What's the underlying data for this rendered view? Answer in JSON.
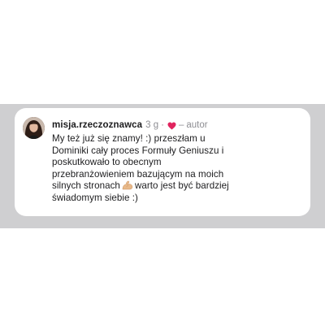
{
  "comment": {
    "username": "misja.rzeczoznawca",
    "time_ago": "3 g",
    "separator": "·",
    "author_dash": "–",
    "author_label": "autor",
    "text_lines": [
      "My też już się znamy! :) przeszłam u",
      "Dominiki cały proces Formuły Geniuszu i",
      "poskutkowało to obecnym",
      "przebranżowieniem bazującym na moich",
      "silnych stronach",
      "warto jest być bardziej",
      "świadomym siebie :)"
    ],
    "emoji": "flexed-biceps-icon",
    "icons": {
      "heart": "heart-icon",
      "avatar": "avatar"
    }
  },
  "colors": {
    "band": "#cfcfd1",
    "heart": "#e0245e",
    "muted_text": "#8e8e93",
    "text": "#1c1c1e"
  }
}
